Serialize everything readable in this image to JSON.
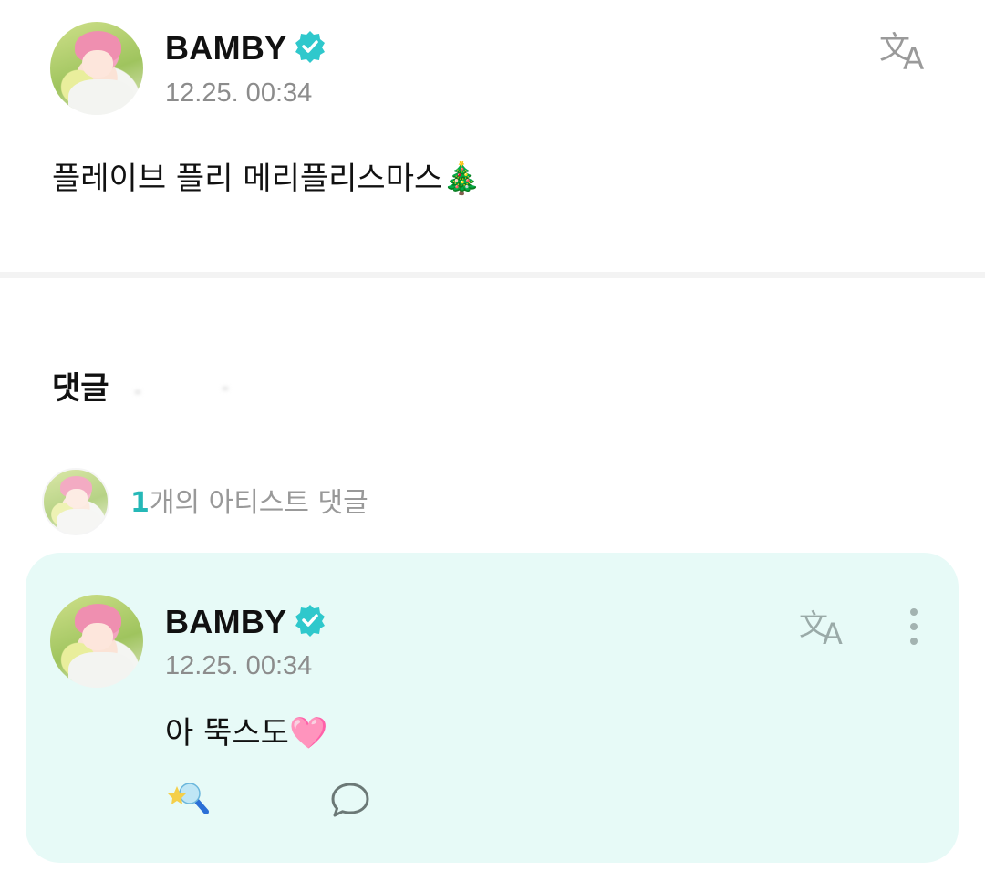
{
  "post": {
    "author_name": "BAMBY",
    "timestamp": "12.25. 00:34",
    "body": "플레이브 플리 메리플리스마스",
    "body_emoji": "🎄"
  },
  "comments": {
    "section_title": "댓글",
    "artist_summary_count": "1",
    "artist_summary_text": "개의 아티스트 댓글",
    "artist_comment": {
      "author_name": "BAMBY",
      "timestamp": "12.25. 00:34",
      "body": "아 뚝스도",
      "body_emoji": "🩷"
    }
  },
  "icons": {
    "verified": "verified-badge-icon",
    "translate": "translate-icon",
    "more": "more-vertical-icon",
    "reaction": "star-lightstick-icon",
    "reply": "speech-bubble-icon"
  },
  "colors": {
    "accent": "#25b8b7",
    "card_bg": "#e7faf7",
    "verified": "#2fc8cc"
  }
}
